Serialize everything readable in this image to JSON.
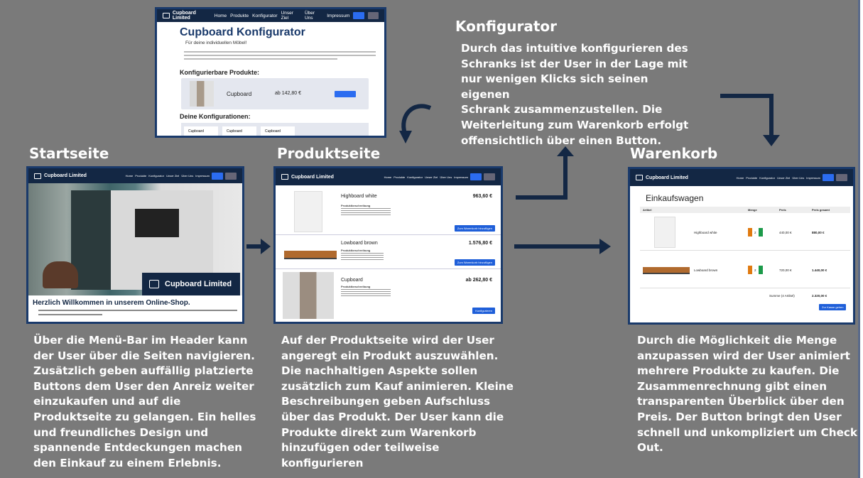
{
  "headings": {
    "konfigurator": "Konfigurator",
    "startseite": "Startseite",
    "produktseite": "Produktseite",
    "warenkorb": "Warenkorb"
  },
  "texts": {
    "konfigurator": "Durch das intuitive konfigurieren des\nSchranks ist der User in der Lage mit\nnur wenigen Klicks sich seinen eigenen\nSchrank zusammenzustellen. Die\nWeiterleitung zum Warenkorb erfolgt\noffensichtlich über einen Button.",
    "startseite": "Über die Menü-Bar im Header kann\nder User über die Seiten navigieren.\nZusätzlich geben auffällig platzierte\nButtons dem User den Anreiz weiter\neinzukaufen und auf die\nProduktseite zu gelangen. Ein helles\nund freundliches Design und\nspannende Entdeckungen machen\nden Einkauf zu einem Erlebnis.",
    "produktseite": "Auf der Produktseite wird der User\nangeregt ein Produkt auszuwählen.\nDie nachhaltigen Aspekte sollen\nzusätzlich zum Kauf animieren. Kleine\nBeschreibungen geben Aufschluss\nüber das Produkt. Der User kann die\nProdukte direkt zum Warenkorb\nhinzufügen oder teilweise\nkonfigurieren",
    "warenkorb": "Durch die Möglichkeit die Menge\nanzupassen wird der User animiert\nmehrere Produkte zu kaufen. Die\nZusammenrechnung gibt einen\ntransparenten Überblick über den\nPreis. Der Button bringt den User\nschnell und unkompliziert um Check\nOut."
  },
  "nav": {
    "brand": "Cupboard Limited",
    "links": [
      "Home",
      "Produkte",
      "Konfigurator",
      "Unser Ziel",
      "Über Uns",
      "Impressum"
    ]
  },
  "konfigurator_shot": {
    "title": "Cupboard Konfigurator",
    "subtitle": "Für deine individuellen Möbel!",
    "section1": "Konfigurierbare Produkte:",
    "product": "Cupboard",
    "price": "ab 142,80 €",
    "section2": "Deine Konfigurationen:",
    "configs": [
      "Cupboard",
      "Cupboard",
      "Cupboard"
    ]
  },
  "start_shot": {
    "overlay": "Cupboard Limited",
    "welcome": "Herzlich Willkommen in unserem Online-Shop."
  },
  "produkt_shot": {
    "items": [
      {
        "name": "Highboard white",
        "price": "963,60 €",
        "desc_title": "Produktbeschreibung",
        "button": "Zum Warenkorb hinzufügen"
      },
      {
        "name": "Lowboard brown",
        "price": "1.576,80 €",
        "desc_title": "Produktbeschreibung",
        "button": "Zum Warenkorb hinzufügen"
      },
      {
        "name": "Cupboard",
        "price": "ab 262,80 €",
        "desc_title": "Produktbeschreibung",
        "button": "Konfigurieren"
      }
    ]
  },
  "warenkorb_shot": {
    "title": "Einkaufswagen",
    "columns": [
      "Artikel",
      "Menge",
      "Preis",
      "Preis gesamt"
    ],
    "rows": [
      {
        "name": "Highboard white",
        "qty": "2",
        "price": "440,00 €",
        "total": "880,00 €"
      },
      {
        "name": "Lowboard brown",
        "qty": "2",
        "price": "720,00 €",
        "total": "1.440,00 €"
      }
    ],
    "sum_label": "Summe (4 Artikel)",
    "sum_value": "2.320,00 €",
    "checkout": "Zur Kasse gehen"
  }
}
